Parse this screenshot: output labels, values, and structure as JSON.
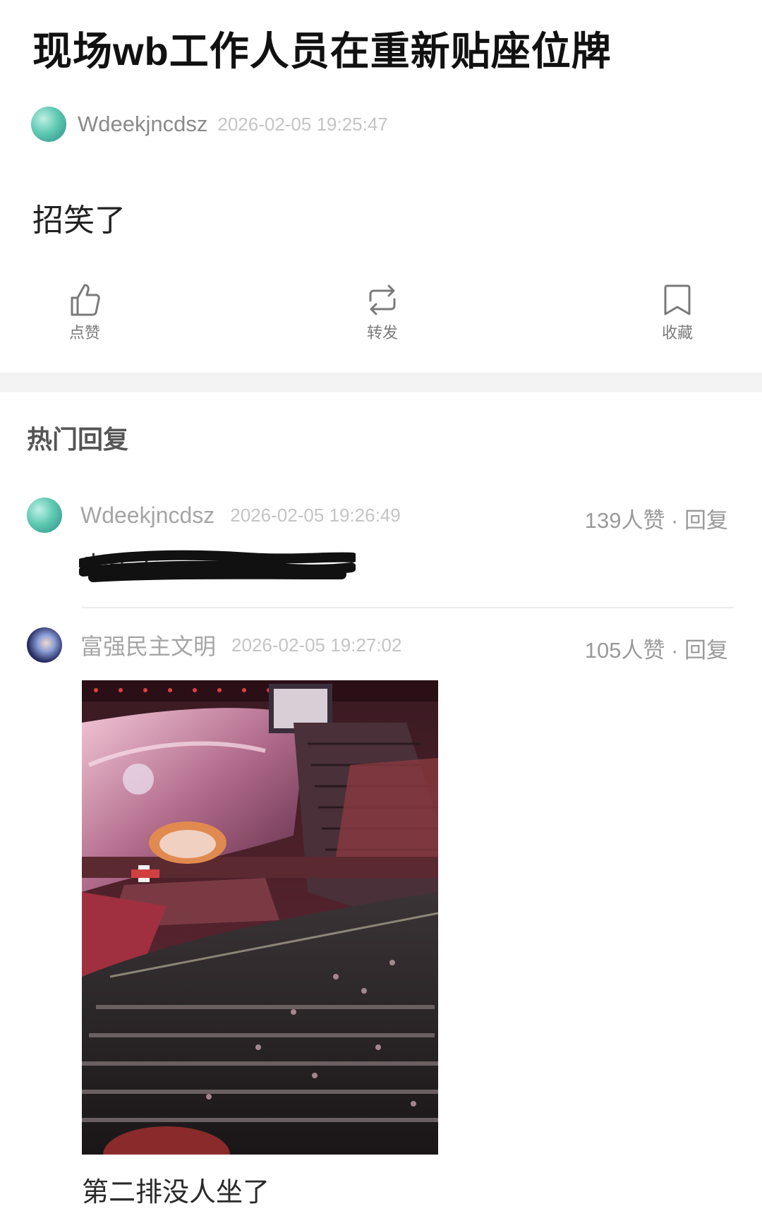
{
  "post": {
    "title": "现场wb工作人员在重新贴座位牌",
    "author": "Wdeekjncdsz",
    "timestamp": "2026-02-05 19:25:47",
    "body": "招笑了"
  },
  "actions": {
    "like_label": "点赞",
    "repost_label": "转发",
    "favorite_label": "收藏"
  },
  "replies_section": {
    "heading": "热门回复",
    "replies": [
      {
        "author": "Wdeekjncdsz",
        "timestamp": "2026-02-05 19:26:49",
        "likes": "139人赞 · 回复",
        "text": "老光奉"
      },
      {
        "author": "富强民主文明",
        "timestamp": "2026-02-05 19:27:02",
        "likes": "105人赞 · 回复",
        "caption": "第二排没人坐了"
      }
    ]
  },
  "colors": {
    "accent_teal": "#5fc9b2",
    "muted_text": "#8a8a8a"
  }
}
